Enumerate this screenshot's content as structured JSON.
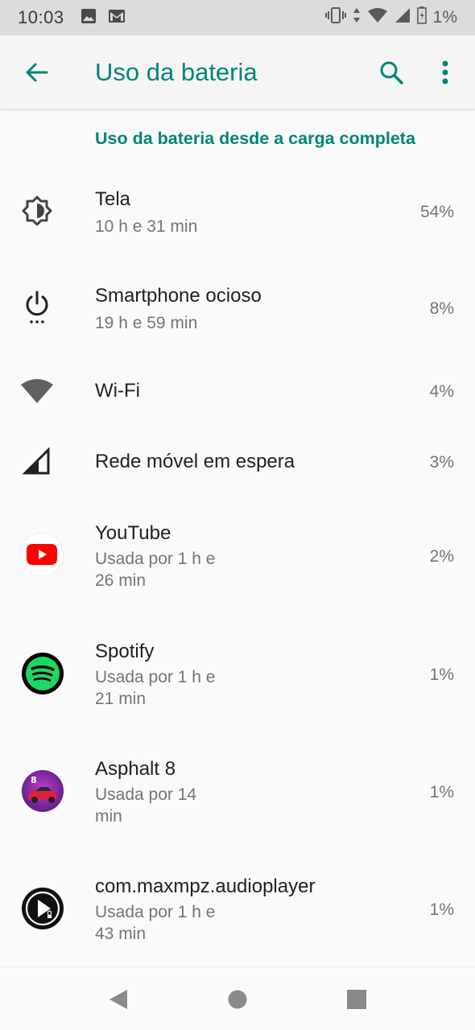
{
  "status_bar": {
    "time": "10:03",
    "battery_percent": "1%",
    "icons": [
      "image-icon",
      "gmail-icon",
      "vibrate-icon",
      "data-arrows-icon",
      "wifi-icon",
      "signal-icon",
      "battery-icon"
    ]
  },
  "app_bar": {
    "title": "Uso da bateria",
    "icons": [
      "back-arrow-icon",
      "search-icon",
      "more-vert-icon"
    ]
  },
  "section_header": "Uso da bateria desde a carga completa",
  "items": [
    {
      "title": "Tela",
      "subtitle": "10 h e 31 min",
      "percent": "54%",
      "icon": "brightness-icon"
    },
    {
      "title": "Smartphone ocioso",
      "subtitle": "19 h e 59 min",
      "percent": "8%",
      "icon": "power-idle-icon"
    },
    {
      "title": "Wi-Fi",
      "subtitle": "",
      "percent": "4%",
      "icon": "wifi-icon"
    },
    {
      "title": "Rede móvel em espera",
      "subtitle": "",
      "percent": "3%",
      "icon": "cell-signal-icon"
    },
    {
      "title": "YouTube",
      "subtitle_line1": "Usada por 1 h e",
      "subtitle_line2": "26 min",
      "percent": "2%",
      "icon": "youtube-icon"
    },
    {
      "title": "Spotify",
      "subtitle_line1": "Usada por 1 h e",
      "subtitle_line2": "21 min",
      "percent": "1%",
      "icon": "spotify-icon"
    },
    {
      "title": "Asphalt 8",
      "subtitle_line1": "Usada por 14",
      "subtitle_line2": "min",
      "percent": "1%",
      "icon": "asphalt-icon"
    },
    {
      "title": "com.maxmpz.audioplayer",
      "subtitle_line1": "Usada por 1 h e",
      "subtitle_line2": "43 min",
      "percent": "1%",
      "icon": "audioplayer-icon"
    }
  ],
  "nav_bar": {
    "icons": [
      "back-triangle-icon",
      "home-circle-icon",
      "recents-square-icon"
    ]
  },
  "colors": {
    "accent": "#008577",
    "status_bar": "#dcdcdc",
    "youtube_red": "#ff0000",
    "spotify_green": "#1ed760"
  }
}
